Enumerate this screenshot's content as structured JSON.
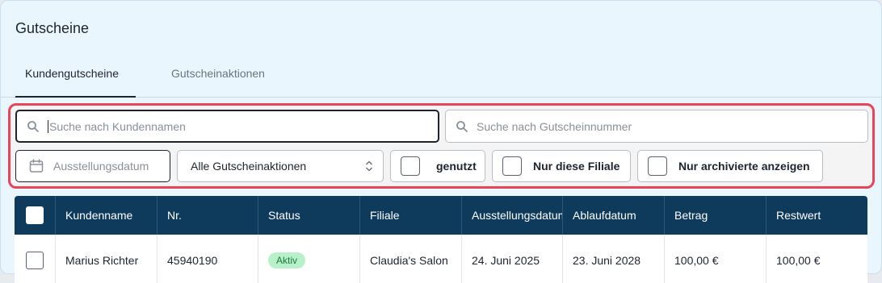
{
  "page_title": "Gutscheine",
  "tabs": [
    {
      "label": "Kundengutscheine",
      "active": true
    },
    {
      "label": "Gutscheinaktionen",
      "active": false
    }
  ],
  "filters": {
    "customer_search": {
      "placeholder": "Suche nach Kundennamen",
      "value": ""
    },
    "voucher_search": {
      "placeholder": "Suche nach Gutscheinnummer",
      "value": ""
    },
    "issue_date": {
      "placeholder": "Ausstellungsdatum",
      "icon": "calendar-icon"
    },
    "campaign_select": {
      "selected": "Alle Gutscheinaktionen",
      "icon": "chevron-up-down-icon"
    },
    "checkboxes": [
      {
        "label": "genutzt",
        "checked": false
      },
      {
        "label": "Nur diese Filiale",
        "checked": false
      },
      {
        "label": "Nur archivierte anzeigen",
        "checked": false
      }
    ]
  },
  "table": {
    "headers": [
      "Kundenname",
      "Nr.",
      "Status",
      "Filiale",
      "Ausstellungsdatum",
      "Ablaufdatum",
      "Betrag",
      "Restwert"
    ],
    "rows": [
      [
        "Marius Richter",
        "45940190",
        "Aktiv",
        "Claudia's Salon",
        "24. Juni 2025",
        "23. Juni 2028",
        "100,00 €",
        "100,00 €"
      ]
    ]
  },
  "colors": {
    "header_bg": "#0e3a5c",
    "highlight_border": "#e8455a",
    "active_badge_bg": "#b7f0c9",
    "active_badge_text": "#1a7a3c"
  }
}
